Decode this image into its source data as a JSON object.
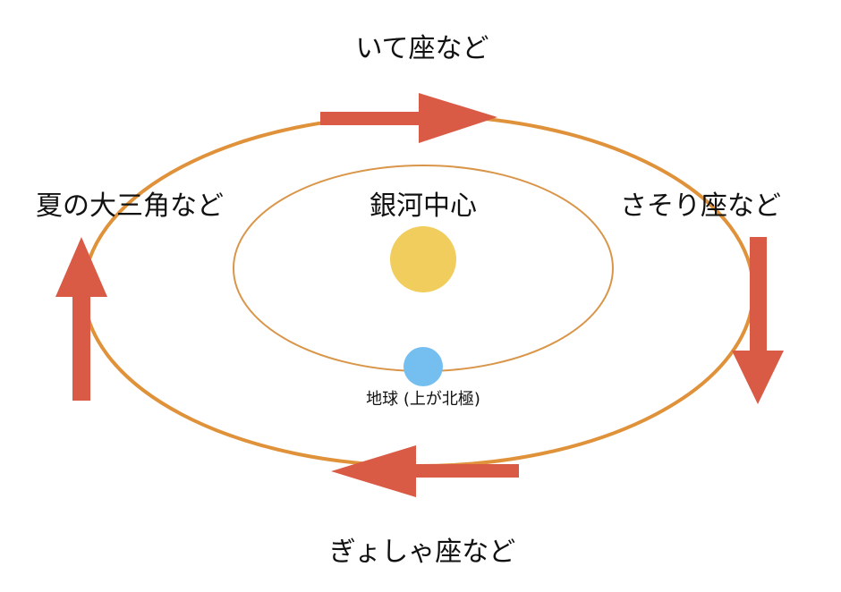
{
  "labels": {
    "top": "いて座など",
    "left": "夏の大三角など",
    "right": "さそり座など",
    "bottom": "ぎょしゃ座など",
    "center": "銀河中心",
    "earth": "地球 (上が北極)"
  },
  "colors": {
    "outer_orbit": "#E0923A",
    "inner_orbit": "#D9964A",
    "galactic_center": "#F0CD5C",
    "earth": "#74BFF0",
    "arrow": "#D95A45",
    "text": "#111111"
  },
  "icons": {
    "galactic_center": "yellow-disc",
    "earth": "blue-disc",
    "arrows": "block-arrow"
  }
}
